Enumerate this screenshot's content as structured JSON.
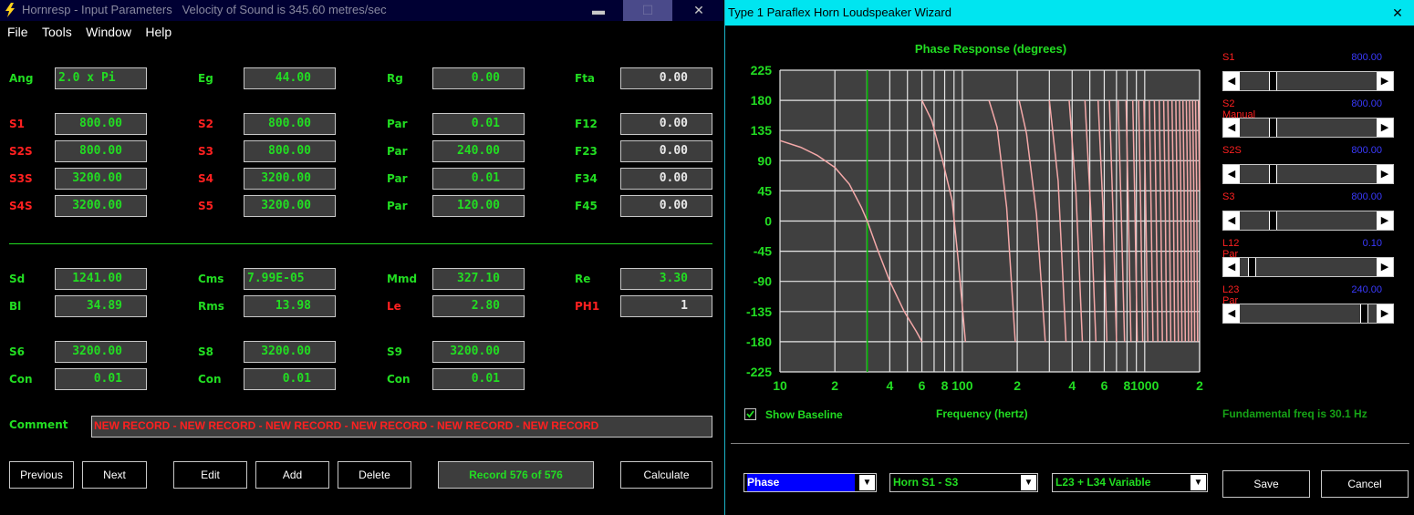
{
  "left_window": {
    "title": "Hornresp - Input Parameters   Velocity of Sound is 345.60 metres/sec",
    "buttons": {
      "minimize": "▬",
      "maximize": "☐",
      "close": "✕"
    },
    "menu": [
      "File",
      "Tools",
      "Window",
      "Help"
    ],
    "fields": [
      {
        "label": "Ang",
        "value": "2.0 x Pi",
        "lc": "g",
        "vc": "g",
        "col": 0,
        "row": 0
      },
      {
        "label": "Eg",
        "value": "44.00",
        "lc": "g",
        "vc": "g",
        "col": 1,
        "row": 0
      },
      {
        "label": "Rg",
        "value": "0.00",
        "lc": "g",
        "vc": "g",
        "col": 2,
        "row": 0
      },
      {
        "label": "Fta",
        "value": "0.00",
        "lc": "g",
        "vc": "w",
        "col": 3,
        "row": 0
      },
      {
        "label": "S1",
        "value": "800.00",
        "lc": "r",
        "vc": "g",
        "col": 0,
        "row": 1
      },
      {
        "label": "S2",
        "value": "800.00",
        "lc": "r",
        "vc": "g",
        "col": 1,
        "row": 1
      },
      {
        "label": "Par",
        "value": "0.01",
        "lc": "g",
        "vc": "g",
        "col": 2,
        "row": 1
      },
      {
        "label": "F12",
        "value": "0.00",
        "lc": "g",
        "vc": "w",
        "col": 3,
        "row": 1
      },
      {
        "label": "S2S",
        "value": "800.00",
        "lc": "r",
        "vc": "g",
        "col": 0,
        "row": 2
      },
      {
        "label": "S3",
        "value": "800.00",
        "lc": "r",
        "vc": "g",
        "col": 1,
        "row": 2
      },
      {
        "label": "Par",
        "value": "240.00",
        "lc": "g",
        "vc": "g",
        "col": 2,
        "row": 2
      },
      {
        "label": "F23",
        "value": "0.00",
        "lc": "g",
        "vc": "w",
        "col": 3,
        "row": 2
      },
      {
        "label": "S3S",
        "value": "3200.00",
        "lc": "r",
        "vc": "g",
        "col": 0,
        "row": 3
      },
      {
        "label": "S4",
        "value": "3200.00",
        "lc": "r",
        "vc": "g",
        "col": 1,
        "row": 3
      },
      {
        "label": "Par",
        "value": "0.01",
        "lc": "g",
        "vc": "g",
        "col": 2,
        "row": 3
      },
      {
        "label": "F34",
        "value": "0.00",
        "lc": "g",
        "vc": "w",
        "col": 3,
        "row": 3
      },
      {
        "label": "S4S",
        "value": "3200.00",
        "lc": "r",
        "vc": "g",
        "col": 0,
        "row": 4
      },
      {
        "label": "S5",
        "value": "3200.00",
        "lc": "r",
        "vc": "g",
        "col": 1,
        "row": 4
      },
      {
        "label": "Par",
        "value": "120.00",
        "lc": "g",
        "vc": "g",
        "col": 2,
        "row": 4
      },
      {
        "label": "F45",
        "value": "0.00",
        "lc": "g",
        "vc": "w",
        "col": 3,
        "row": 4
      },
      {
        "label": "Sd",
        "value": "1241.00",
        "lc": "g",
        "vc": "g",
        "col": 0,
        "row": 5
      },
      {
        "label": "Cms",
        "value": "7.99E-05",
        "lc": "g",
        "vc": "g",
        "col": 1,
        "row": 5,
        "align": "left"
      },
      {
        "label": "Mmd",
        "value": "327.10",
        "lc": "g",
        "vc": "g",
        "col": 2,
        "row": 5
      },
      {
        "label": "Re",
        "value": "3.30",
        "lc": "g",
        "vc": "g",
        "col": 3,
        "row": 5
      },
      {
        "label": "Bl",
        "value": "34.89",
        "lc": "g",
        "vc": "g",
        "col": 0,
        "row": 6
      },
      {
        "label": "Rms",
        "value": "13.98",
        "lc": "g",
        "vc": "g",
        "col": 1,
        "row": 6
      },
      {
        "label": "Le",
        "value": "2.80",
        "lc": "r",
        "vc": "g",
        "col": 2,
        "row": 6
      },
      {
        "label": "PH1",
        "value": "1",
        "lc": "r",
        "vc": "w",
        "col": 3,
        "row": 6
      },
      {
        "label": "S6",
        "value": "3200.00",
        "lc": "g",
        "vc": "g",
        "col": 0,
        "row": 7
      },
      {
        "label": "S8",
        "value": "3200.00",
        "lc": "g",
        "vc": "g",
        "col": 1,
        "row": 7
      },
      {
        "label": "S9",
        "value": "3200.00",
        "lc": "g",
        "vc": "g",
        "col": 2,
        "row": 7
      },
      {
        "label": "Con",
        "value": "0.01",
        "lc": "g",
        "vc": "g",
        "col": 0,
        "row": 8
      },
      {
        "label": "Con",
        "value": "0.01",
        "lc": "g",
        "vc": "g",
        "col": 1,
        "row": 8
      },
      {
        "label": "Con",
        "value": "0.01",
        "lc": "g",
        "vc": "g",
        "col": 2,
        "row": 8
      }
    ],
    "comment_label": "Comment",
    "comment_value": "NEW RECORD - NEW RECORD - NEW RECORD - NEW RECORD - NEW RECORD - NEW RECORD",
    "nav_buttons": {
      "previous": "Previous",
      "next": "Next",
      "edit": "Edit",
      "add": "Add",
      "delete": "Delete",
      "calculate": "Calculate"
    },
    "record_status": "Record 576 of 576",
    "colors": {
      "green": "#22dd22",
      "red": "#ff2020"
    }
  },
  "right_window": {
    "title": "Type 1 Paraflex Horn Loudspeaker Wizard",
    "close": "✕",
    "sliders": [
      {
        "label": "S1",
        "value": "800.00",
        "pos": 0.22
      },
      {
        "label": "S2 Manual",
        "value": "800.00",
        "pos": 0.22
      },
      {
        "label": "S2S",
        "value": "800.00",
        "pos": 0.22
      },
      {
        "label": "S3",
        "value": "800.00",
        "pos": 0.22
      },
      {
        "label": "L12 Par",
        "value": "0.10",
        "pos": 0.05
      },
      {
        "label": "L23 Par",
        "value": "240.00",
        "pos": 0.95
      }
    ],
    "show_baseline_label": "Show Baseline",
    "show_baseline_checked": true,
    "fundamental": "Fundamental freq is 30.1 Hz",
    "dropdowns": [
      "Phase",
      "Horn S1 - S3",
      "L23 + L34 Variable"
    ],
    "buttons": {
      "save": "Save",
      "cancel": "Cancel"
    },
    "colors": {
      "curve": "#f4a8a8",
      "baseline": "#00c000",
      "slider_value": "#3a3aff"
    }
  },
  "chart_data": {
    "type": "line",
    "title": "Phase Response (degrees)",
    "xlabel": "Frequency (hertz)",
    "ylabel": "",
    "x_scale": "log",
    "xlim": [
      10,
      2000
    ],
    "ylim": [
      -225,
      225
    ],
    "yticks": [
      225,
      180,
      135,
      90,
      45,
      0,
      -45,
      -90,
      -135,
      -180,
      -225
    ],
    "xtick_labels": [
      {
        "x": 10,
        "label": "10"
      },
      {
        "x": 20,
        "label": "2"
      },
      {
        "x": 40,
        "label": "4"
      },
      {
        "x": 60,
        "label": "6"
      },
      {
        "x": 80,
        "label": "8"
      },
      {
        "x": 100,
        "label": "100"
      },
      {
        "x": 200,
        "label": "2"
      },
      {
        "x": 400,
        "label": "4"
      },
      {
        "x": 600,
        "label": "6"
      },
      {
        "x": 800,
        "label": "8"
      },
      {
        "x": 1000,
        "label": "1000"
      },
      {
        "x": 2000,
        "label": "2"
      }
    ],
    "baseline_x": 30.1,
    "grid": true,
    "series": [
      {
        "name": "",
        "wraps": [
          {
            "x": [
              10,
              13,
              16,
              20,
              24,
              28,
              30.1,
              34,
              40,
              48,
              56,
              60
            ],
            "y": [
              120,
              110,
              98,
              80,
              55,
              20,
              0,
              -40,
              -90,
              -135,
              -165,
              -180
            ]
          },
          {
            "x": [
              60,
              68,
              78,
              88,
              95,
              104
            ],
            "y": [
              180,
              150,
              90,
              30,
              -60,
              -180
            ]
          },
          {
            "x": [
              140,
              155,
              175,
              195
            ],
            "y": [
              180,
              140,
              20,
              -180
            ]
          },
          {
            "x": [
              205,
              225,
              255,
              285
            ],
            "y": [
              180,
              130,
              10,
              -180
            ]
          },
          {
            "x": [
              300,
              335,
              370
            ],
            "y": [
              180,
              60,
              -180
            ]
          },
          {
            "x": [
              385,
              420,
              455
            ],
            "y": [
              180,
              40,
              -180
            ]
          },
          {
            "x": [
              470,
              505,
              540
            ],
            "y": [
              180,
              20,
              -180
            ]
          },
          {
            "x": [
              555,
              590,
              620
            ],
            "y": [
              180,
              20,
              -180
            ]
          },
          {
            "x": [
              640,
              670,
              700
            ],
            "y": [
              180,
              10,
              -180
            ]
          },
          {
            "x": [
              715,
              745,
              775
            ],
            "y": [
              180,
              0,
              -180
            ]
          },
          {
            "x": [
              790,
              815,
              840
            ],
            "y": [
              180,
              0,
              -180
            ]
          },
          {
            "x": [
              860,
              885,
              910
            ],
            "y": [
              180,
              10,
              -180
            ]
          },
          {
            "x": [
              925,
              950,
              975
            ],
            "y": [
              180,
              20,
              -180
            ]
          },
          {
            "x": [
              990,
              1015,
              1040
            ],
            "y": [
              180,
              10,
              -180
            ]
          },
          {
            "x": [
              1060,
              1085,
              1110
            ],
            "y": [
              180,
              10,
              -180
            ]
          },
          {
            "x": [
              1130,
              1155,
              1180
            ],
            "y": [
              180,
              20,
              -180
            ]
          },
          {
            "x": [
              1200,
              1225,
              1250
            ],
            "y": [
              180,
              20,
              -180
            ]
          },
          {
            "x": [
              1270,
              1295,
              1320
            ],
            "y": [
              180,
              30,
              -180
            ]
          },
          {
            "x": [
              1340,
              1365,
              1390
            ],
            "y": [
              180,
              30,
              -180
            ]
          },
          {
            "x": [
              1410,
              1435,
              1460
            ],
            "y": [
              180,
              40,
              -180
            ]
          },
          {
            "x": [
              1480,
              1505,
              1530
            ],
            "y": [
              180,
              40,
              -180
            ]
          },
          {
            "x": [
              1550,
              1575,
              1600
            ],
            "y": [
              180,
              50,
              -180
            ]
          },
          {
            "x": [
              1620,
              1645,
              1670
            ],
            "y": [
              180,
              50,
              -180
            ]
          },
          {
            "x": [
              1690,
              1715,
              1740
            ],
            "y": [
              180,
              60,
              -180
            ]
          },
          {
            "x": [
              1760,
              1785,
              1810
            ],
            "y": [
              180,
              60,
              -180
            ]
          },
          {
            "x": [
              1830,
              1855,
              1880
            ],
            "y": [
              180,
              60,
              -180
            ]
          },
          {
            "x": [
              1900,
              1925,
              1950
            ],
            "y": [
              180,
              50,
              -180
            ]
          },
          {
            "x": [
              1970,
              2000
            ],
            "y": [
              180,
              45
            ]
          }
        ]
      }
    ]
  }
}
